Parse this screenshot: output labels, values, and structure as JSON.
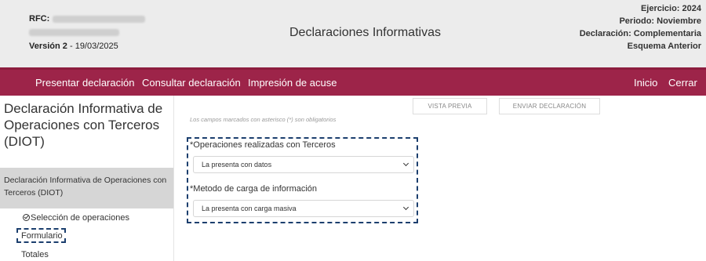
{
  "header": {
    "rfc_label": "RFC:",
    "version_label": "Versión 2",
    "version_date": " - 19/03/2025",
    "app_title": "Declaraciones Informativas",
    "ejercicio": "Ejercicio: 2024",
    "periodo": "Periodo: Noviembre",
    "declaracion": "Declaración: Complementaria",
    "esquema": "Esquema Anterior"
  },
  "nav": {
    "presentar": "Presentar declaración",
    "consultar": "Consultar declaración",
    "impresion": "Impresión de acuse",
    "inicio": "Inicio",
    "cerrar": "Cerrar"
  },
  "sidebar": {
    "title": "Declaración Informativa de Operaciones con Terceros (DIOT)",
    "section": "Declaración Informativa de Operaciones con Terceros (DIOT)",
    "items": [
      {
        "label": "Selección de operaciones"
      },
      {
        "label": "Formulario"
      },
      {
        "label": "Totales"
      }
    ]
  },
  "main": {
    "vista_previa": "VISTA PREVIA",
    "enviar": "ENVIAR DECLARACIÓN",
    "note": "Los campos marcados con asterisco (*) son obligatorios",
    "field1_label": "*Operaciones realizadas con Terceros",
    "field1_value": "La presenta con datos",
    "field2_label": "*Metodo de carga de información",
    "field2_value": "La presenta con carga masiva"
  },
  "colors": {
    "nav_bg": "#9d2449",
    "header_bg": "#ececec",
    "highlight_border": "#1c3f6e"
  }
}
